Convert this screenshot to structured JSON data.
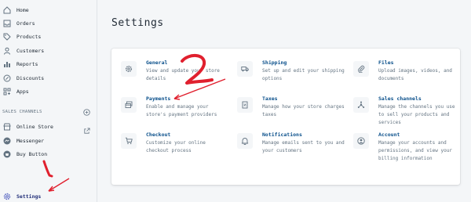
{
  "sidebar": {
    "items": [
      {
        "label": "Home",
        "icon": "home-icon"
      },
      {
        "label": "Orders",
        "icon": "orders-icon"
      },
      {
        "label": "Products",
        "icon": "tag-icon"
      },
      {
        "label": "Customers",
        "icon": "person-icon"
      },
      {
        "label": "Reports",
        "icon": "bar-chart-icon"
      },
      {
        "label": "Discounts",
        "icon": "discount-icon"
      },
      {
        "label": "Apps",
        "icon": "apps-icon"
      }
    ],
    "section_label": "SALES CHANNELS",
    "channels": [
      {
        "label": "Online Store",
        "icon": "store-icon"
      },
      {
        "label": "Messenger",
        "icon": "messenger-icon"
      },
      {
        "label": "Buy Button",
        "icon": "buy-button-icon"
      }
    ],
    "settings_label": "Settings"
  },
  "main": {
    "title": "Settings",
    "tiles": [
      {
        "title": "General",
        "desc": "View and update your store details",
        "icon": "gear-icon"
      },
      {
        "title": "Shipping",
        "desc": "Set up and edit your shipping options",
        "icon": "truck-icon"
      },
      {
        "title": "Files",
        "desc": "Upload images, videos, and documents",
        "icon": "paperclip-icon"
      },
      {
        "title": "Payments",
        "desc": "Enable and manage your store's payment providers",
        "icon": "payments-icon"
      },
      {
        "title": "Taxes",
        "desc": "Manage how your store charges taxes",
        "icon": "taxes-icon"
      },
      {
        "title": "Sales channels",
        "desc": "Manage the channels you use to sell your products and services",
        "icon": "channels-icon"
      },
      {
        "title": "Checkout",
        "desc": "Customize your online checkout process",
        "icon": "cart-icon"
      },
      {
        "title": "Notifications",
        "desc": "Manage emails sent to you and your customers",
        "icon": "bell-icon"
      },
      {
        "title": "Account",
        "desc": "Manage your accounts and permissions, and view your billing information",
        "icon": "account-icon"
      }
    ]
  },
  "colors": {
    "accent_link": "#084e8a",
    "annotation": "#e0202e",
    "background": "#f4f6f8"
  }
}
